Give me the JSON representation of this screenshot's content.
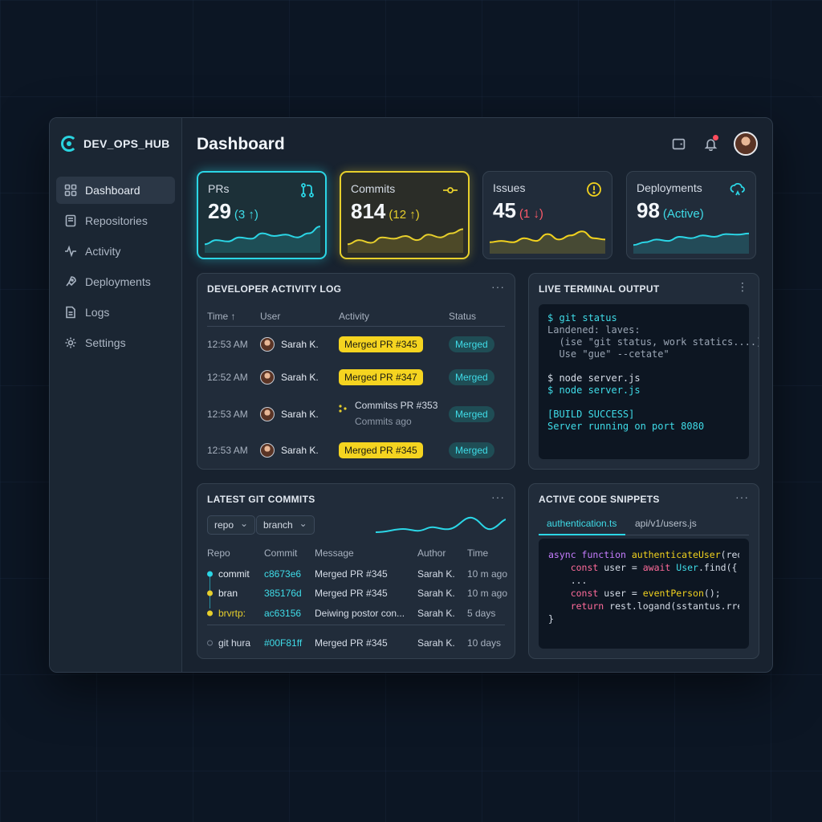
{
  "brand": {
    "name": "DEV_OPS_HUB"
  },
  "sidebar": {
    "items": [
      {
        "label": "Dashboard",
        "icon": "grid-icon",
        "active": true
      },
      {
        "label": "Repositories",
        "icon": "repo-icon"
      },
      {
        "label": "Activity",
        "icon": "pulse-icon"
      },
      {
        "label": "Deployments",
        "icon": "rocket-icon"
      },
      {
        "label": "Logs",
        "icon": "document-icon"
      },
      {
        "label": "Settings",
        "icon": "gear-icon"
      }
    ]
  },
  "header": {
    "title": "Dashboard"
  },
  "kpis": [
    {
      "label": "PRs",
      "value": "29",
      "delta": "(3 ↑)",
      "icon": "pull-request-icon",
      "accent": "#2bd6e6",
      "spark": [
        0.2,
        0.35,
        0.3,
        0.45,
        0.4,
        0.6,
        0.5,
        0.55,
        0.45,
        0.6,
        0.85
      ]
    },
    {
      "label": "Commits",
      "value": "814",
      "delta": "(12 ↑)",
      "icon": "commit-icon",
      "accent": "#e7cf2c",
      "spark": [
        0.2,
        0.35,
        0.25,
        0.45,
        0.4,
        0.5,
        0.35,
        0.55,
        0.45,
        0.6,
        0.75
      ]
    },
    {
      "label": "Issues",
      "value": "45",
      "delta": "(1 ↓)",
      "icon": "alert-circle-icon",
      "accent": "#f2d21e",
      "delta_color": "#ff5a6a",
      "spark": [
        0.3,
        0.35,
        0.3,
        0.45,
        0.35,
        0.6,
        0.4,
        0.55,
        0.7,
        0.45,
        0.4
      ]
    },
    {
      "label": "Deployments",
      "value": "98",
      "delta": "(Active)",
      "icon": "cloud-icon",
      "accent": "#2bd6e6",
      "spark": [
        0.2,
        0.3,
        0.4,
        0.35,
        0.5,
        0.45,
        0.55,
        0.5,
        0.6,
        0.58,
        0.62
      ]
    }
  ],
  "activity_log": {
    "title": "DEVELOPER ACTIVITY LOG",
    "columns": [
      "Time ↑",
      "User",
      "Activity",
      "Status"
    ],
    "rows": [
      {
        "time": "12:53 AM",
        "user": "Sarah K.",
        "activity": "Merged PR #345",
        "type": "pill",
        "status": "Merged"
      },
      {
        "time": "12:52 AM",
        "user": "Sarah K.",
        "activity": "Merged PR #347",
        "type": "pill",
        "status": "Merged"
      },
      {
        "time": "12:53 AM",
        "user": "Sarah K.",
        "activity": "Commitss PR #353",
        "sub": "Commits ago",
        "type": "commit",
        "status": "Merged"
      },
      {
        "time": "12:53 AM",
        "user": "Sarah K.",
        "activity": "Merged PR #345",
        "type": "pill",
        "status": "Merged"
      }
    ]
  },
  "terminal": {
    "title": "LIVE TERMINAL OUTPUT",
    "lines": [
      {
        "text": "$ git status",
        "color": "#3fdce8"
      },
      {
        "text": "Landened: laves:",
        "color": "#9aa5b4"
      },
      {
        "text": "  (ise \"git status, work statics....)",
        "color": "#9aa5b4"
      },
      {
        "text": "  Use \"gue\" --cetate\"",
        "color": "#9aa5b4"
      },
      {
        "text": "",
        "color": "#9aa5b4"
      },
      {
        "text": "$ node server.js",
        "color": "#d6dde8"
      },
      {
        "text": "$ node server.js",
        "color": "#3fdce8"
      },
      {
        "text": "",
        "color": "#9aa5b4"
      },
      {
        "text": "[BUILD SUCCESS]",
        "color": "#3fdce8"
      },
      {
        "text": "Server running on port 8080",
        "color": "#3fdce8"
      }
    ]
  },
  "git_commits": {
    "title": "LATEST GIT COMMITS",
    "repo_filter": "repo",
    "branch_filter": "branch",
    "columns": [
      "Repo",
      "Commit",
      "Message",
      "Author",
      "Time"
    ],
    "rows": [
      {
        "repo": "commit",
        "hash": "c8673e6",
        "message": "Merged PR #345",
        "author": "Sarah K.",
        "time": "10 m ago",
        "dot": "#2bd6e6",
        "repo_color": "#e6ecf4"
      },
      {
        "repo": "bran",
        "hash": "385176d",
        "message": "Merged PR #345",
        "author": "Sarah K.",
        "time": "10 m ago",
        "dot": "#e7cf2c",
        "repo_color": "#e6ecf4"
      },
      {
        "repo": "brvrtp:",
        "hash": "ac63156",
        "message": "Deiwing postor con...",
        "author": "Sarah K.",
        "time": "5 days",
        "dot": "#e7cf2c",
        "repo_color": "#e7cf2c"
      },
      {
        "repo": "git hura",
        "hash": "#00F81ff",
        "message": "Merged PR #345",
        "author": "Sarah K.",
        "time": "10 days",
        "dot": "#6c7888",
        "repo_color": "#d6dde8"
      }
    ]
  },
  "snippets": {
    "title": "ACTIVE CODE SNIPPETS",
    "tabs": [
      "authentication.ts",
      "api/v1/users.js"
    ],
    "lines": [
      "async function authenticateUser(req, res) {",
      "    const user = await User.find({ username });",
      "    ...",
      "",
      "    const user = eventPerson();",
      "    return rest.logand(sstantus.rresl);",
      "}"
    ]
  },
  "colors": {
    "accent_cyan": "#2bd6e6",
    "accent_yellow": "#e7cf2c",
    "danger": "#ff5a6a",
    "bg": "#0c1624"
  }
}
